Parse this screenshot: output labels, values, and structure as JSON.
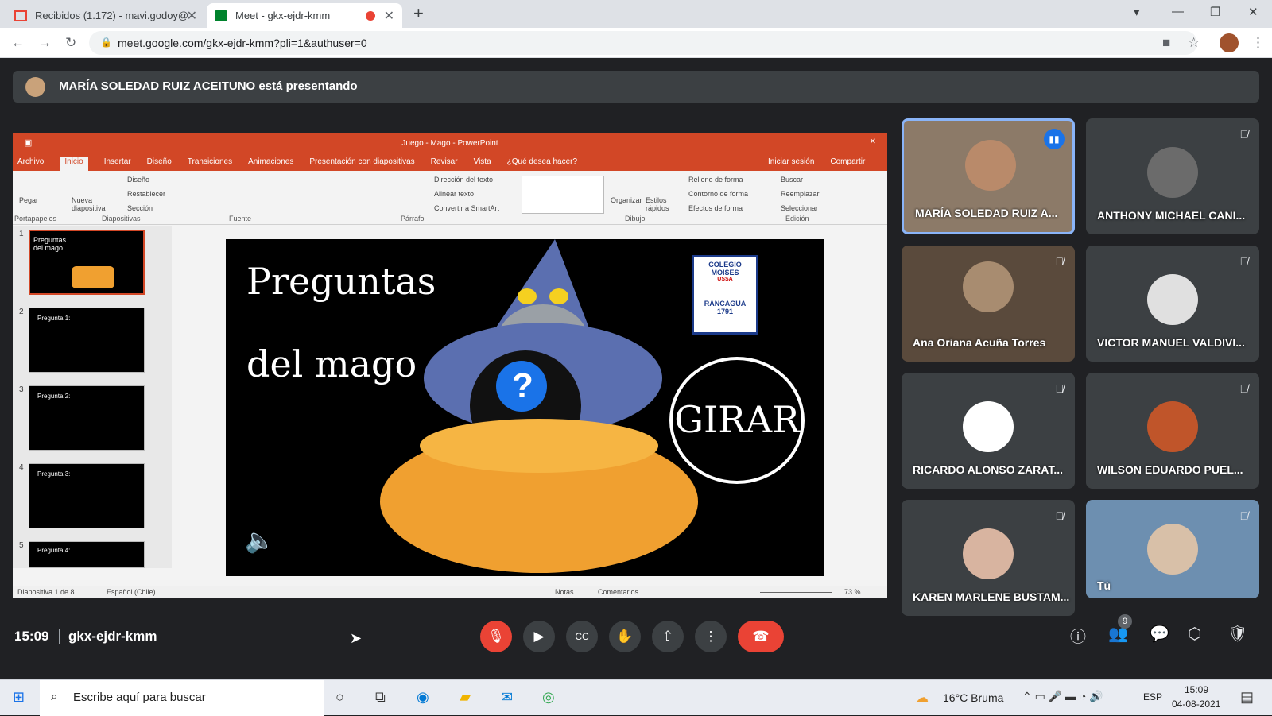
{
  "browser": {
    "tabs": [
      {
        "title": "Recibidos (1.172) - mavi.godoy@",
        "active": false
      },
      {
        "title": "Meet - gkx-ejdr-kmm",
        "active": true
      }
    ],
    "url": "meet.google.com/gkx-ejdr-kmm?pli=1&authuser=0"
  },
  "presenter": {
    "banner": "MARÍA SOLEDAD RUIZ ACEITUNO está presentando"
  },
  "ppt": {
    "window_title": "Juego - Mago - PowerPoint",
    "menu": [
      "Archivo",
      "Inicio",
      "Insertar",
      "Diseño",
      "Transiciones",
      "Animaciones",
      "Presentación con diapositivas",
      "Revisar",
      "Vista",
      "¿Qué desea hacer?"
    ],
    "account": {
      "login": "Iniciar sesión",
      "share": "Compartir"
    },
    "ribbon": {
      "paste": "Pegar",
      "new_slide": "Nueva diapositiva",
      "layout": "Diseño",
      "reset": "Restablecer",
      "section": "Sección",
      "text_dir": "Dirección del texto",
      "align_text": "Alinear texto",
      "smartart": "Convertir a SmartArt",
      "arrange": "Organizar",
      "quick_styles": "Estilos rápidos",
      "fill": "Relleno de forma",
      "outline": "Contorno de forma",
      "effects": "Efectos de forma",
      "find": "Buscar",
      "replace": "Reemplazar",
      "select": "Seleccionar",
      "groups": {
        "clipboard": "Portapapeles",
        "slides": "Diapositivas",
        "font": "Fuente",
        "paragraph": "Párrafo",
        "drawing": "Dibujo",
        "editing": "Edición"
      }
    },
    "slides": [
      {
        "num": "1",
        "text": "Preguntas del mago"
      },
      {
        "num": "2",
        "text": "Pregunta 1:"
      },
      {
        "num": "3",
        "text": "Pregunta 2:"
      },
      {
        "num": "4",
        "text": "Pregunta 3:"
      },
      {
        "num": "5",
        "text": "Pregunta 4:"
      }
    ],
    "current_slide": {
      "title_line1": "Preguntas",
      "title_line2": "del mago",
      "badge_line1": "COLEGIO",
      "badge_line2": "MOISES",
      "badge_side": "USSA",
      "badge_city": "RANCAGUA",
      "badge_year": "1791",
      "button": "GIRAR",
      "question_mark": "?"
    },
    "status": {
      "slide_info": "Diapositiva 1 de 8",
      "language": "Español (Chile)",
      "notes": "Notas",
      "comments": "Comentarios",
      "zoom": "73 %"
    }
  },
  "participants": [
    {
      "name": "MARÍA SOLEDAD RUIZ A...",
      "speaking": true,
      "avatar_color": "#b98a6a"
    },
    {
      "name": "ANTHONY MICHAEL CANI...",
      "muted": true,
      "avatar_color": "#6b6b6b"
    },
    {
      "name": "Ana Oriana Acuña Torres",
      "muted": true,
      "avatar_color": "#a88c70"
    },
    {
      "name": "VICTOR MANUEL VALDIVI...",
      "muted": true,
      "avatar_color": "#e0e0e0"
    },
    {
      "name": "RICARDO ALONSO ZARAT...",
      "muted": true,
      "avatar_color": "#ffffff"
    },
    {
      "name": "WILSON EDUARDO PUEL...",
      "muted": true,
      "avatar_color": "#c0552a"
    },
    {
      "name": "KAREN MARLENE BUSTAM...",
      "muted": true,
      "avatar_color": "#d8b4a0"
    },
    {
      "name": "Tú",
      "muted": true,
      "avatar_color": "#6d8fb0"
    }
  ],
  "call": {
    "time": "15:09",
    "code": "gkx-ejdr-kmm",
    "people_count": "9"
  },
  "taskbar": {
    "search_placeholder": "Escribe aquí para buscar",
    "weather": "16°C Bruma",
    "lang": "ESP",
    "time": "15:09",
    "date": "04-08-2021"
  },
  "colors": {
    "ppt_red": "#d24726",
    "meet_bg": "#202124",
    "end_call": "#ea4335",
    "accent_blue": "#1a73e8"
  }
}
